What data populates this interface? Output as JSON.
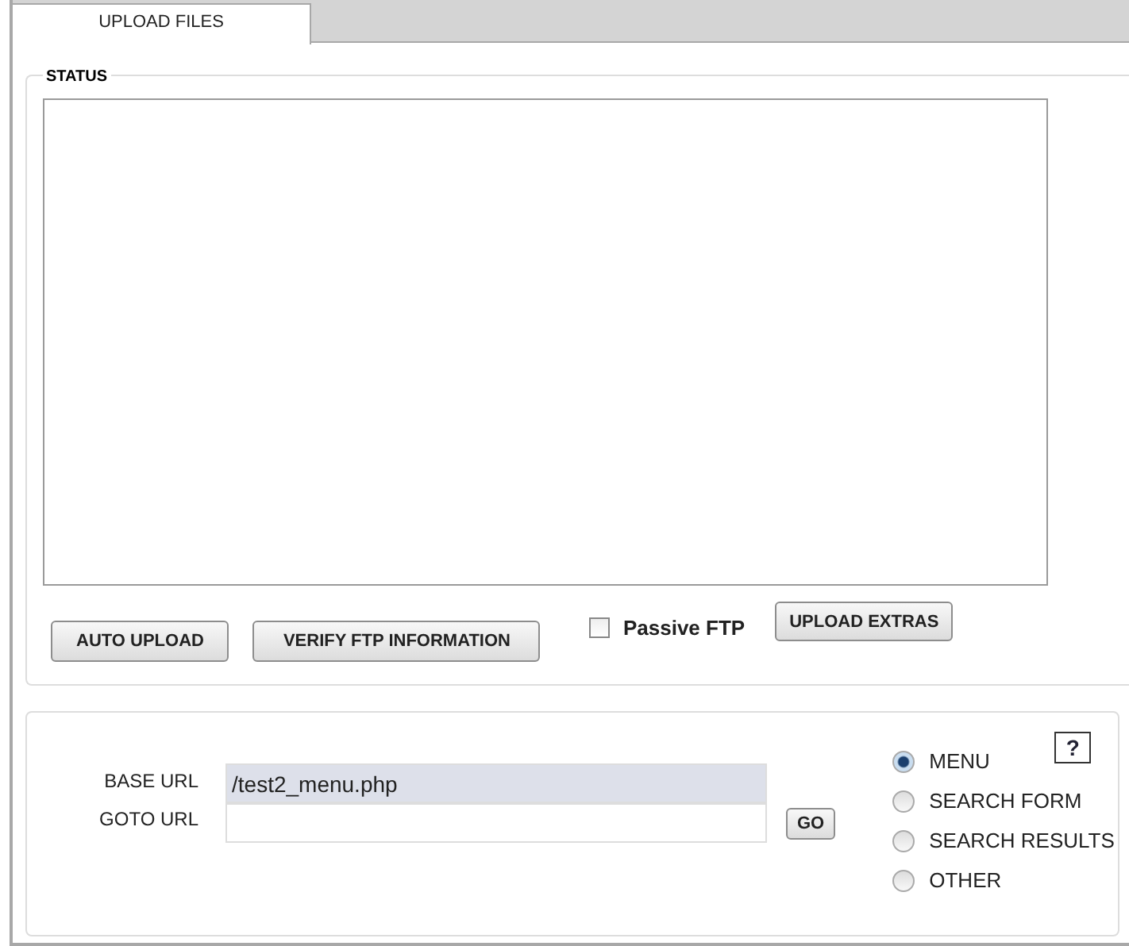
{
  "tabs": [
    {
      "label": "UPLOAD FILES",
      "selected": true
    }
  ],
  "status": {
    "legend": "STATUS"
  },
  "actions": {
    "auto_upload": "AUTO UPLOAD",
    "verify": "VERIFY FTP INFORMATION",
    "passive_ftp": {
      "label": "Passive FTP",
      "checked": false
    },
    "upload_extras": "UPLOAD EXTRAS"
  },
  "url_panel": {
    "base_url": {
      "label": "BASE URL",
      "value": "/test2_menu.php"
    },
    "goto_url": {
      "label": "GOTO URL"
    },
    "go_button": "GO",
    "help": "?",
    "page_types": [
      {
        "label": "MENU",
        "selected": true
      },
      {
        "label": "SEARCH FORM",
        "selected": false
      },
      {
        "label": "SEARCH RESULTS",
        "selected": false
      },
      {
        "label": "OTHER",
        "selected": false
      }
    ]
  }
}
